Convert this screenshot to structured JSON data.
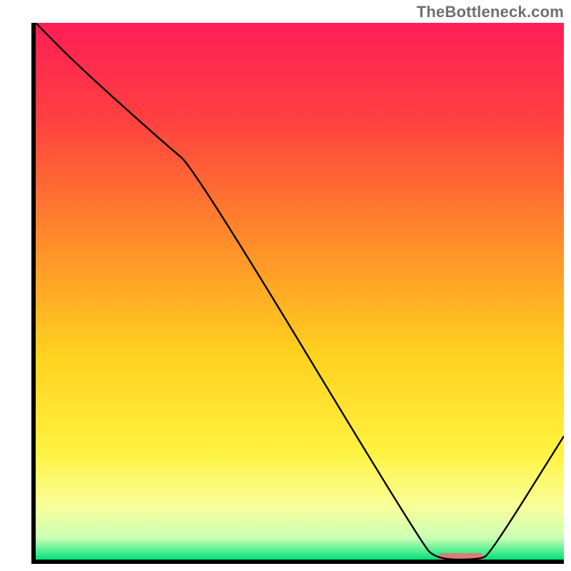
{
  "watermark": "TheBottleneck.com",
  "chart_data": {
    "type": "line",
    "title": "",
    "xlabel": "",
    "ylabel": "",
    "xlim": [
      0,
      100
    ],
    "ylim": [
      0,
      100
    ],
    "grid": false,
    "legend": false,
    "series": [
      {
        "name": "curve",
        "x": [
          0,
          8,
          25,
          30,
          73,
          76,
          84,
          86,
          100
        ],
        "values": [
          100,
          92,
          77,
          73,
          3,
          0,
          0,
          1,
          23
        ]
      }
    ],
    "marker": {
      "x_center": 80.5,
      "y": 0,
      "half_width": 4.3,
      "color": "#dc7b79"
    },
    "gradient_stops": [
      {
        "pct": 0,
        "color": "#ff1e56"
      },
      {
        "pct": 18,
        "color": "#ff4040"
      },
      {
        "pct": 40,
        "color": "#ff8a2a"
      },
      {
        "pct": 62,
        "color": "#ffd21f"
      },
      {
        "pct": 80,
        "color": "#fff240"
      },
      {
        "pct": 90,
        "color": "#f9ff9a"
      },
      {
        "pct": 96,
        "color": "#caffb4"
      },
      {
        "pct": 100,
        "color": "#00e37a"
      }
    ],
    "axis_color": "#000000",
    "line_color": "#000000"
  }
}
